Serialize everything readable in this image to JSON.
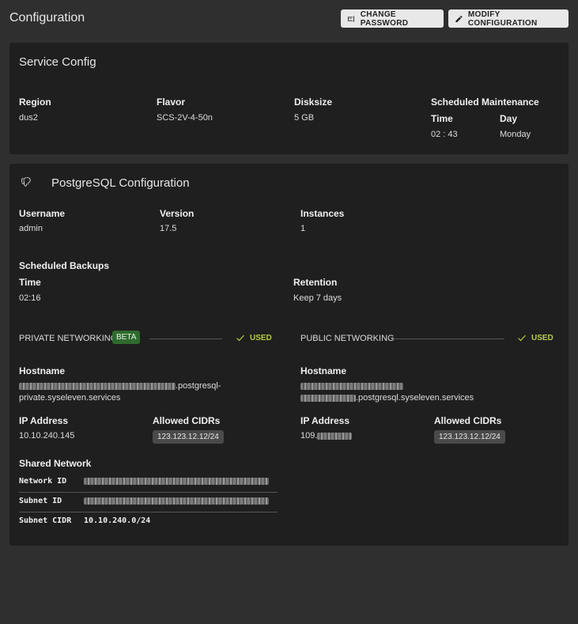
{
  "page": {
    "title": "Configuration"
  },
  "toolbar": {
    "change_password_label": "CHANGE PASSWORD",
    "modify_configuration_label": "MODIFY CONFIGURATION"
  },
  "service_config": {
    "title": "Service Config",
    "region": {
      "label": "Region",
      "value": "dus2"
    },
    "flavor": {
      "label": "Flavor",
      "value": "SCS-2V-4-50n"
    },
    "disksize": {
      "label": "Disksize",
      "value": "5 GB"
    },
    "maintenance": {
      "label": "Scheduled Maintenance",
      "time_label": "Time",
      "time_value": "02 : 43",
      "day_label": "Day",
      "day_value": "Monday"
    }
  },
  "postgres": {
    "title": "PostgreSQL Configuration",
    "username": {
      "label": "Username",
      "value": "admin"
    },
    "version": {
      "label": "Version",
      "value": "17.5"
    },
    "instances": {
      "label": "Instances",
      "value": "1"
    },
    "backups": {
      "label": "Scheduled Backups",
      "time_label": "Time",
      "time_value": "02:16",
      "retention_label": "Retention",
      "retention_value": "Keep 7 days"
    },
    "private": {
      "label": "PRIVATE NETWORKING",
      "badge": "BETA",
      "status": "USED",
      "hostname_label": "Hostname",
      "hostname_suffix_1": ".postgresql-",
      "hostname_suffix_2": "private.syseleven.services",
      "ip_label": "IP Address",
      "ip_value": "10.10.240.145",
      "cidrs_label": "Allowed CIDRs",
      "cidr": "123.123.12.12/24"
    },
    "public": {
      "label": "PUBLIC NETWORKING",
      "status": "USED",
      "hostname_label": "Hostname",
      "hostname_suffix": ".postgresql.syseleven.services",
      "ip_label": "IP Address",
      "ip_prefix": "109.",
      "cidrs_label": "Allowed CIDRs",
      "cidr": "123.123.12.12/24"
    },
    "shared_network": {
      "label": "Shared Network",
      "network_id_label": "Network ID",
      "subnet_id_label": "Subnet ID",
      "subnet_cidr_label": "Subnet CIDR",
      "subnet_cidr_value": "10.10.240.0/24"
    }
  },
  "colors": {
    "accent_used": "#b5cd44",
    "beta_badge": "#2e6b2e",
    "card_bg": "#1f1f1f",
    "page_bg": "#2f2f2f"
  }
}
